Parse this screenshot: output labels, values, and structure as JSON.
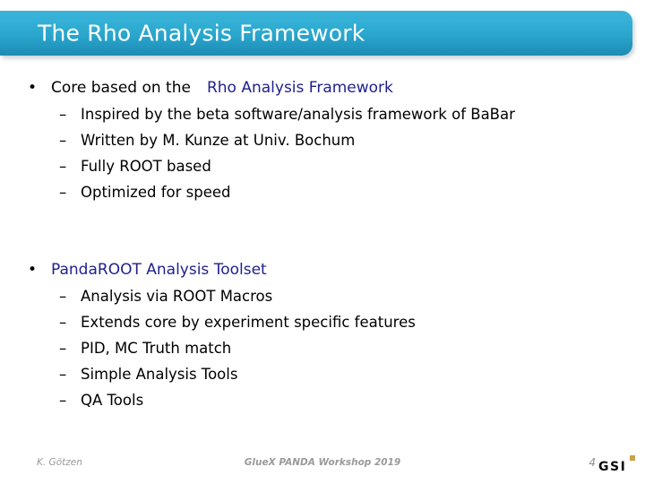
{
  "slide": {
    "title": "The Rho Analysis Framework",
    "title_bar_color_top": "#3ab3d8",
    "title_bar_color_bottom": "#1f8cb5",
    "accent_blue": "#1f1f8f",
    "background": "#ffffff"
  },
  "groups": [
    {
      "bullet_marker": "•",
      "lead_text": "Core based on the",
      "lead_highlight": "Rho Analysis Framework",
      "sub_marker": "–",
      "items": [
        "Inspired by the beta software/analysis framework of BaBar",
        "Written by M. Kunze at Univ. Bochum",
        "Fully ROOT based",
        "Optimized for speed"
      ]
    },
    {
      "bullet_marker": "•",
      "lead_text": "",
      "lead_highlight": "PandaROOT Analysis Toolset",
      "sub_marker": "–",
      "items": [
        "Analysis via ROOT Macros",
        "Extends core by experiment specific features",
        "PID, MC Truth match",
        "Simple Analysis Tools",
        "QA Tools"
      ]
    }
  ],
  "footer": {
    "author": "K. Götzen",
    "event": "GlueX PANDA Workshop 2019",
    "page_number": "4",
    "logo_text": "GSI",
    "logo_accent_color": "#c9a24a"
  }
}
